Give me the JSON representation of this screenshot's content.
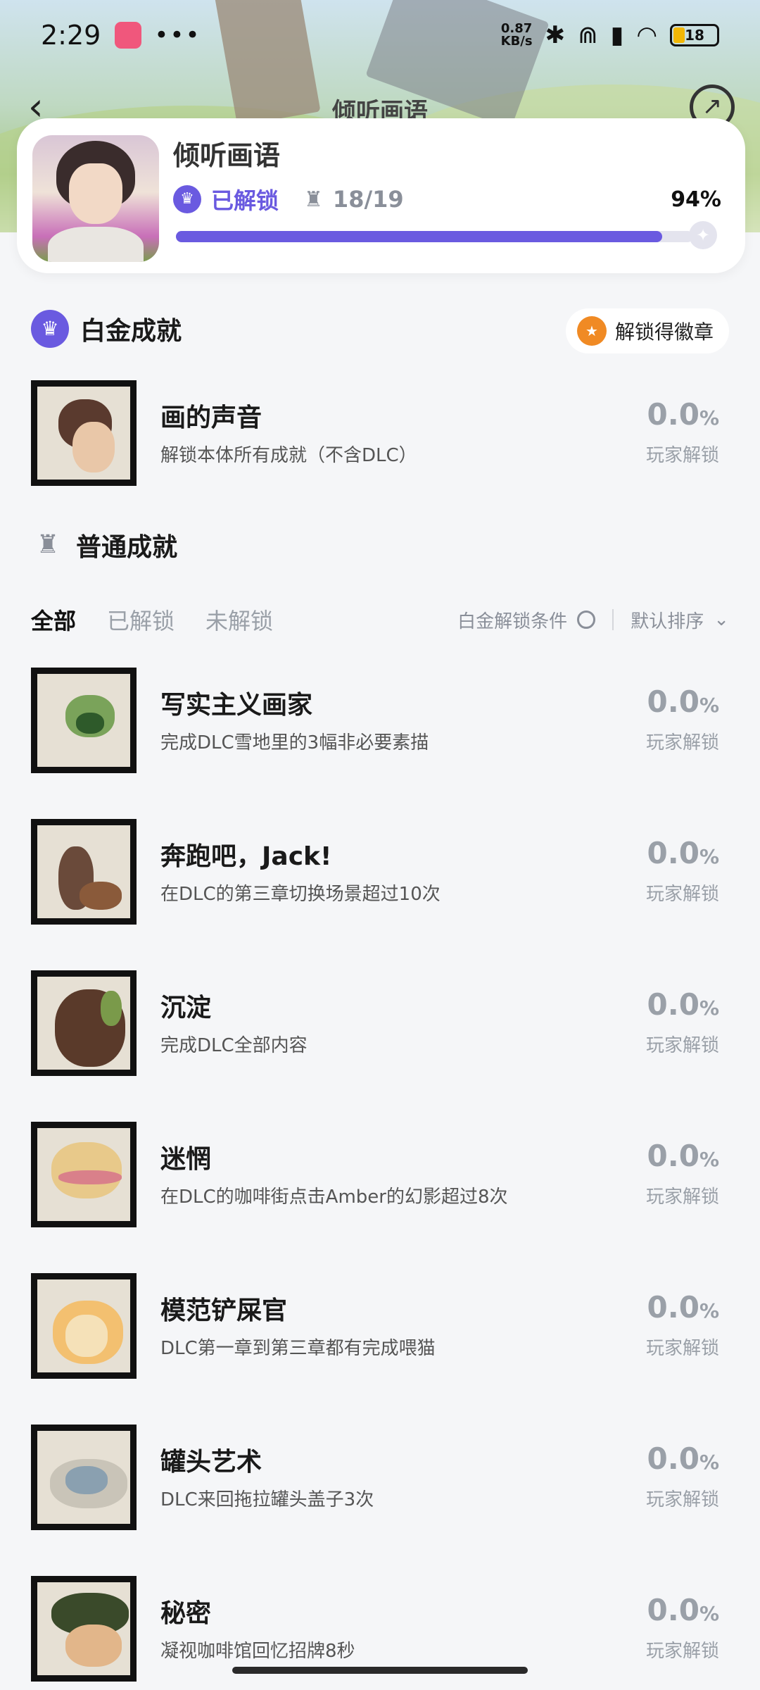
{
  "status_bar": {
    "time": "2:29",
    "dots": "•••",
    "speed_value": "0.87",
    "speed_unit": "KB/s",
    "battery": "18"
  },
  "nav": {
    "title": "倾听画语",
    "back_glyph": "‹",
    "share_glyph": "↗"
  },
  "game": {
    "name": "倾听画语",
    "unlocked_label": "已解锁",
    "trophy_count": "18/19",
    "percent": "94%",
    "progress": 0.94
  },
  "platinum": {
    "section_title": "白金成就",
    "badge_button": "解锁得徽章",
    "item": {
      "title": "画的声音",
      "desc": "解锁本体所有成就（不含DLC）",
      "percent": "0.0",
      "percent_unit": "%",
      "sub": "玩家解锁"
    }
  },
  "normal": {
    "section_title": "普通成就",
    "tabs": [
      "全部",
      "已解锁",
      "未解锁"
    ],
    "filter_label": "白金解锁条件",
    "sort_label": "默认排序",
    "items": [
      {
        "title": "写实主义画家",
        "desc": "完成DLC雪地里的3幅非必要素描",
        "percent": "0.0",
        "unit": "%",
        "sub": "玩家解锁"
      },
      {
        "title": "奔跑吧，Jack!",
        "desc": "在DLC的第三章切换场景超过10次",
        "percent": "0.0",
        "unit": "%",
        "sub": "玩家解锁"
      },
      {
        "title": "沉淀",
        "desc": "完成DLC全部内容",
        "percent": "0.0",
        "unit": "%",
        "sub": "玩家解锁"
      },
      {
        "title": "迷惘",
        "desc": "在DLC的咖啡街点击Amber的幻影超过8次",
        "percent": "0.0",
        "unit": "%",
        "sub": "玩家解锁"
      },
      {
        "title": "模范铲屎官",
        "desc": "DLC第一章到第三章都有完成喂猫",
        "percent": "0.0",
        "unit": "%",
        "sub": "玩家解锁"
      },
      {
        "title": "罐头艺术",
        "desc": "DLC来回拖拉罐头盖子3次",
        "percent": "0.0",
        "unit": "%",
        "sub": "玩家解锁"
      },
      {
        "title": "秘密",
        "desc": "凝视咖啡馆回忆招牌8秒",
        "percent": "0.0",
        "unit": "%",
        "sub": "玩家解锁"
      }
    ]
  },
  "colors": {
    "accent": "#6a5ae0",
    "muted": "#9aa0a8",
    "background": "#f5f6f8"
  }
}
